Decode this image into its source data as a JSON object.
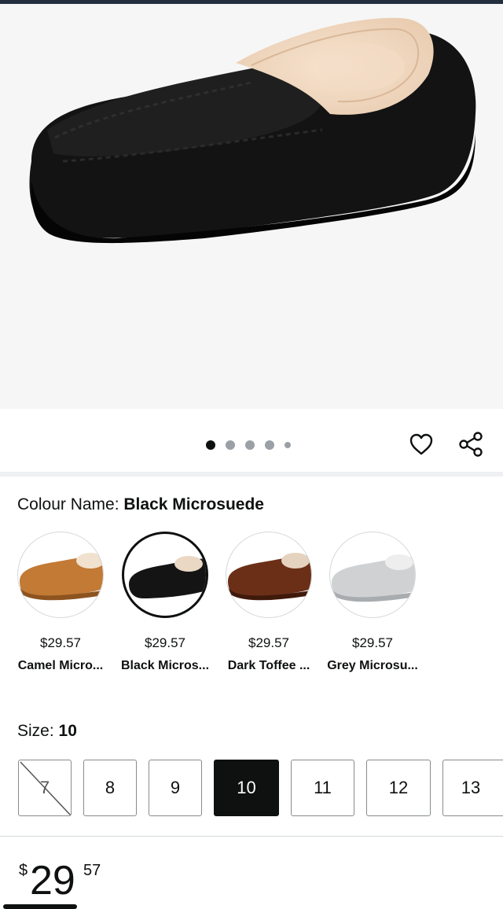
{
  "gallery": {
    "image_count": 5,
    "active_index": 0,
    "wishlist_icon": "heart-icon",
    "share_icon": "share-icon"
  },
  "colour": {
    "label": "Colour Name: ",
    "selected": "Black Microsuede",
    "options": [
      {
        "price": "$29.57",
        "name": "Camel Micro...",
        "color": "#c27a35"
      },
      {
        "price": "$29.57",
        "name": "Black Micros...",
        "color": "#141414"
      },
      {
        "price": "$29.57",
        "name": "Dark Toffee ...",
        "color": "#6b2f17"
      },
      {
        "price": "$29.57",
        "name": "Grey Microsu...",
        "color": "#cfd1d3"
      }
    ]
  },
  "size": {
    "label": "Size: ",
    "selected": "10",
    "options": [
      "7",
      "8",
      "9",
      "10",
      "11",
      "12",
      "13"
    ],
    "unavailable": [
      "7"
    ]
  },
  "price": {
    "symbol": "$",
    "whole": "29",
    "fraction": "57"
  }
}
